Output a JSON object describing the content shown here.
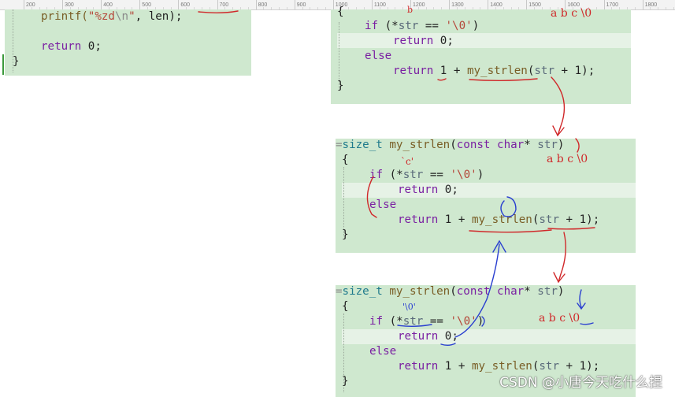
{
  "ruler": {
    "labels": [
      "200",
      "300",
      "400",
      "500",
      "600",
      "700",
      "800",
      "900",
      "1000",
      "1100",
      "1200",
      "1300",
      "1400",
      "1500",
      "1600",
      "1700",
      "1800"
    ]
  },
  "panel1": {
    "lines": [
      {
        "t1": "printf(",
        "t2": "\"%zd",
        "t3": "\\n",
        "t4": "\"",
        ", len);": ""
      },
      {
        "text": ""
      }
    ],
    "printf_fn": "printf(",
    "printf_str": "\"%zd",
    "printf_esc": "\\n",
    "printf_strend": "\"",
    "printf_rest": ", len);",
    "return_kw": "return",
    "return_val": " 0;",
    "close_brace": "}"
  },
  "panel2": {
    "open_brace": "{",
    "if_kw": "if",
    "if_open": " (*",
    "if_id": "str",
    "if_op": " == ",
    "if_char": "'\\0'",
    "if_close": ")",
    "return1_kw": "return",
    "return1_val": " 0;",
    "else_kw": "else",
    "return2_kw": "return",
    "return2_mid": " 1 + ",
    "return2_fn": "my_strlen",
    "return2_open": "(",
    "return2_id": "str",
    "return2_end": " + 1);",
    "close_brace": "}"
  },
  "panel3": {
    "sig_ty": "size_t",
    "sig_fn": "my_strlen",
    "sig_open": "(",
    "sig_const": "const",
    "sig_char": "char",
    "sig_star": "*",
    "sig_id": "str",
    "sig_close": ")",
    "open_brace": "{",
    "if_kw": "if",
    "if_open": " (*",
    "if_id": "str",
    "if_op": " == ",
    "if_char": "'\\0'",
    "if_close": ")",
    "return1_kw": "return",
    "return1_val": " 0;",
    "else_kw": "else",
    "return2_kw": "return",
    "return2_mid": " 1 + ",
    "return2_fn": "my_strlen",
    "return2_open": "(",
    "return2_id": "str",
    "return2_end": " + 1);",
    "close_brace": "}"
  },
  "panel4": {
    "sig_ty": "size_t",
    "sig_fn": "my_strlen",
    "sig_open": "(",
    "sig_const": "const",
    "sig_char": "char",
    "sig_star": "*",
    "sig_id": "str",
    "sig_close": ")",
    "open_brace": "{",
    "if_kw": "if",
    "if_open": " (*",
    "if_id": "str",
    "if_op": " == ",
    "if_char": "'\\0'",
    "if_close": ")",
    "return1_kw": "return",
    "return1_val": " 0;",
    "else_kw": "else",
    "return2_kw": "return",
    "return2_mid": " 1 + ",
    "return2_fn": "my_strlen",
    "return2_open": "(",
    "return2_id": "str",
    "return2_end": " + 1);",
    "close_brace": "}"
  },
  "annotations": {
    "abc_top": "a b c \\0",
    "abc_mid": "a b c \\0",
    "abc_bot": "a b c \\0",
    "mark_b": "b",
    "mark_c": "`c'",
    "mark_zero": "'\\0'"
  },
  "colors": {
    "panel_bg": "#cfe8cf",
    "ink_red": "#d0282a",
    "ink_blue": "#2a3fd0"
  },
  "watermark": "CSDN @小唐今天吃什么捏"
}
